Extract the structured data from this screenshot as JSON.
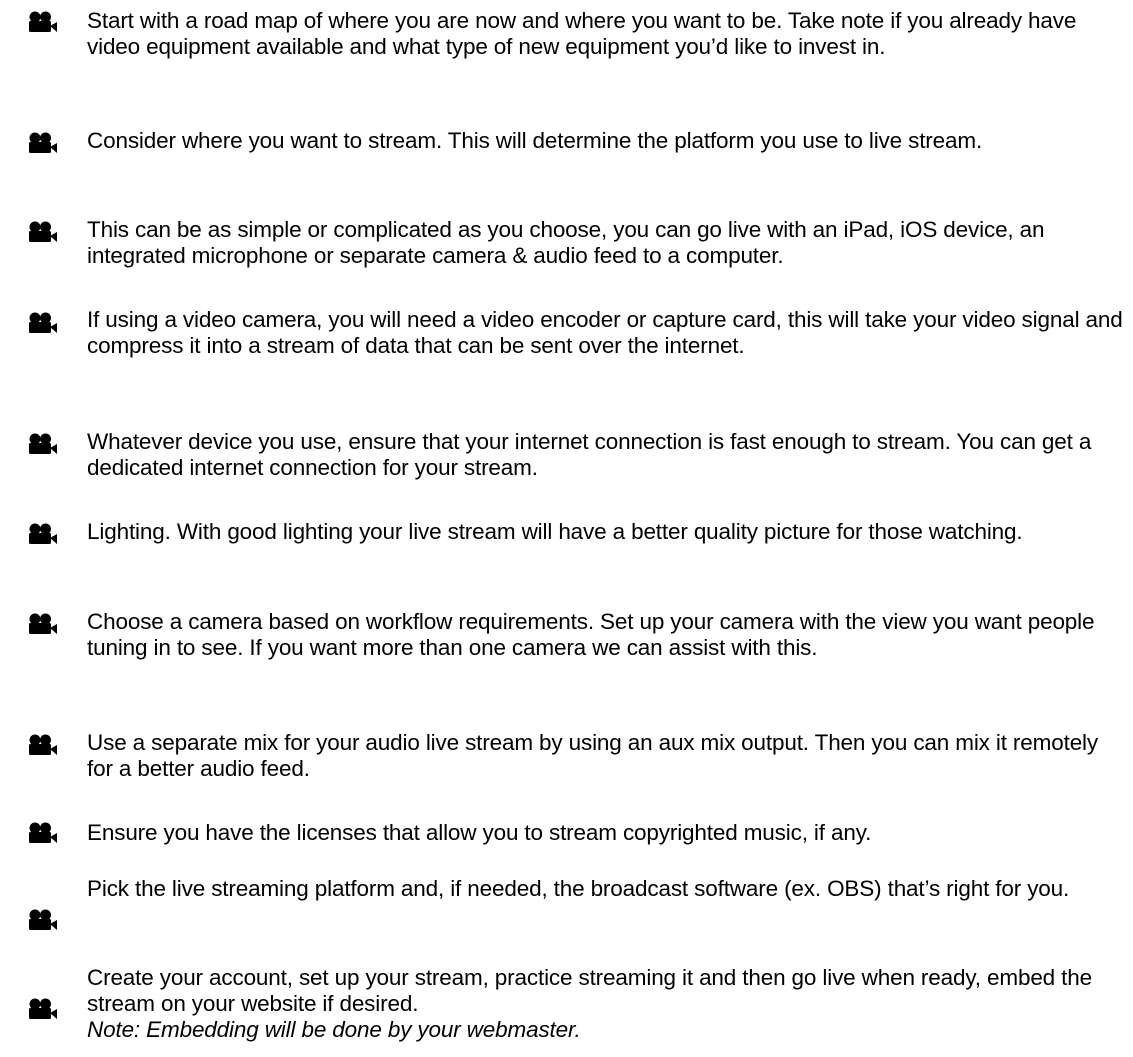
{
  "checklist": {
    "items": [
      {
        "text": "Start with a road map of where you are now and where you want to be. Take note if you already have video equipment available and what type of new equipment you’d like to invest in."
      },
      {
        "text": "Consider where you want to stream. This will determine the platform you use to live stream."
      },
      {
        "text": "This can be as simple or complicated as you choose, you can go live with an iPad, iOS device, an integrated microphone or separate camera & audio feed to a computer."
      },
      {
        "text": "If using a video camera, you will need a video encoder or capture card, this will take your video signal and compress it into a stream of data that can be sent over the internet."
      },
      {
        "text": "Whatever device you use, ensure that your internet connection is fast enough to stream. You can get a dedicated internet connection for your stream."
      },
      {
        "text": "Lighting. With good lighting your live stream will have a better quality picture for those watching."
      },
      {
        "text": "Choose a camera based on workflow requirements. Set up your camera with the view you want people tuning in to see. If you want more than one camera we can assist with this."
      },
      {
        "text": "Use a separate mix for your audio live stream by using an aux mix output. Then you can mix it remotely for a better audio feed."
      },
      {
        "text": "Ensure you have the licenses that allow you to stream copyrighted music, if any."
      },
      {
        "text": "Pick the live streaming platform and, if needed, the broadcast software (ex. OBS) that’s right for you."
      },
      {
        "text": "Create your account, set up your stream, practice streaming it and then go live when ready, embed the stream on your website if desired.",
        "note": "Note: Embedding will be done by your webmaster."
      }
    ],
    "bullet_icon": "video-camera-icon",
    "text_color": "#000000"
  }
}
